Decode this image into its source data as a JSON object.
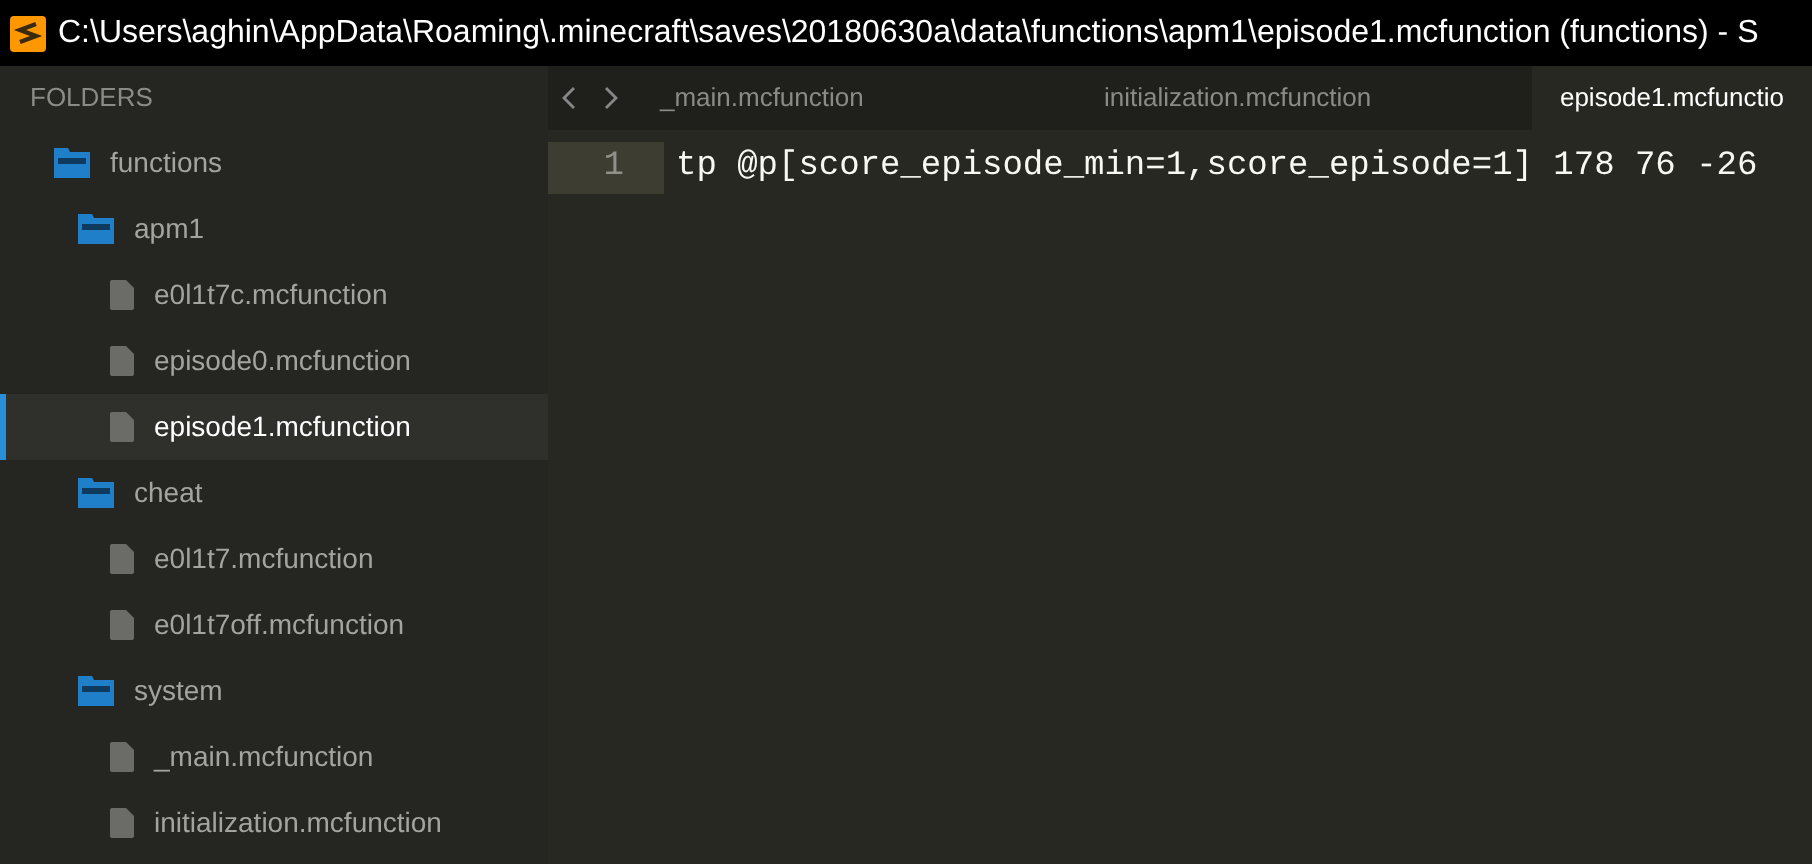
{
  "window": {
    "title": "C:\\Users\\aghin\\AppData\\Roaming\\.minecraft\\saves\\20180630a\\data\\functions\\apm1\\episode1.mcfunction (functions) - S"
  },
  "sidebar": {
    "header": "FOLDERS",
    "tree": [
      {
        "kind": "folder",
        "label": "functions",
        "selected": false,
        "children": [
          {
            "kind": "folder",
            "label": "apm1",
            "selected": false,
            "children": [
              {
                "kind": "file",
                "label": "e0l1t7c.mcfunction",
                "selected": false
              },
              {
                "kind": "file",
                "label": "episode0.mcfunction",
                "selected": false
              },
              {
                "kind": "file",
                "label": "episode1.mcfunction",
                "selected": true
              }
            ]
          },
          {
            "kind": "folder",
            "label": "cheat",
            "selected": false,
            "children": [
              {
                "kind": "file",
                "label": "e0l1t7.mcfunction",
                "selected": false
              },
              {
                "kind": "file",
                "label": "e0l1t7off.mcfunction",
                "selected": false
              }
            ]
          },
          {
            "kind": "folder",
            "label": "system",
            "selected": false,
            "children": [
              {
                "kind": "file",
                "label": "_main.mcfunction",
                "selected": false
              },
              {
                "kind": "file",
                "label": "initialization.mcfunction",
                "selected": false
              }
            ]
          }
        ]
      }
    ]
  },
  "tabs": [
    {
      "label": "_main.mcfunction",
      "selected": false
    },
    {
      "label": "initialization.mcfunction",
      "selected": false
    },
    {
      "label": "episode1.mcfunctio",
      "selected": true
    }
  ],
  "editor": {
    "lines": [
      {
        "number": "1",
        "text": "tp @p[score_episode_min=1,score_episode=1] 178 76 -26"
      }
    ]
  }
}
